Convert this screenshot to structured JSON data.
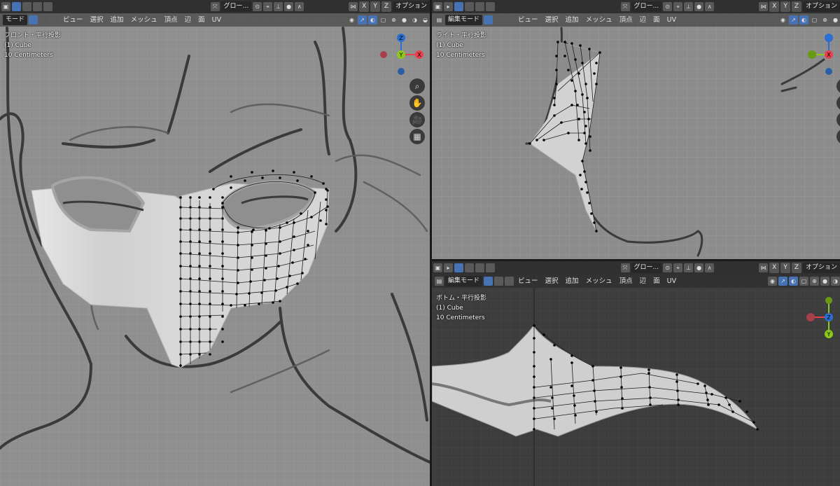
{
  "toolbar": {
    "global_label": "グロー...",
    "option_label": "オプション",
    "axis_x": "X",
    "axis_y": "Y",
    "axis_z": "Z",
    "mode_left": "モード",
    "mode_label": "編集モード",
    "menus": {
      "view": "ビュー",
      "select": "選択",
      "add": "追加",
      "mesh": "メッシュ",
      "vertex": "頂点",
      "edge": "辺",
      "face": "面",
      "uv": "UV"
    }
  },
  "viewports": {
    "front": {
      "view_name": "フロント・平行投影",
      "object": "(1) Cube",
      "scale": "10 Centimeters"
    },
    "right": {
      "view_name": "ライト・平行投影",
      "object": "(1) Cube",
      "scale": "10 Centimeters"
    },
    "bottom": {
      "view_name": "ボトム・平行投影",
      "object": "(1) Cube",
      "scale": "10 Centimeters"
    }
  },
  "gizmo": {
    "x": "X",
    "y": "Y",
    "z": "Z"
  },
  "icons": [
    "zoom-icon",
    "hand-pan-icon",
    "camera-icon",
    "grid-icon",
    "eye-icon",
    "snap-icon",
    "overlay-icon",
    "shading-icon"
  ],
  "colors": {
    "header": "#303030",
    "button": "#545454",
    "active": "#4772b3",
    "front_bg": "#8e8e8e",
    "bottom_bg": "#3d3d3d",
    "axis_x": "#e8404c",
    "axis_y": "#8cc919",
    "axis_z": "#2c6ed1"
  }
}
